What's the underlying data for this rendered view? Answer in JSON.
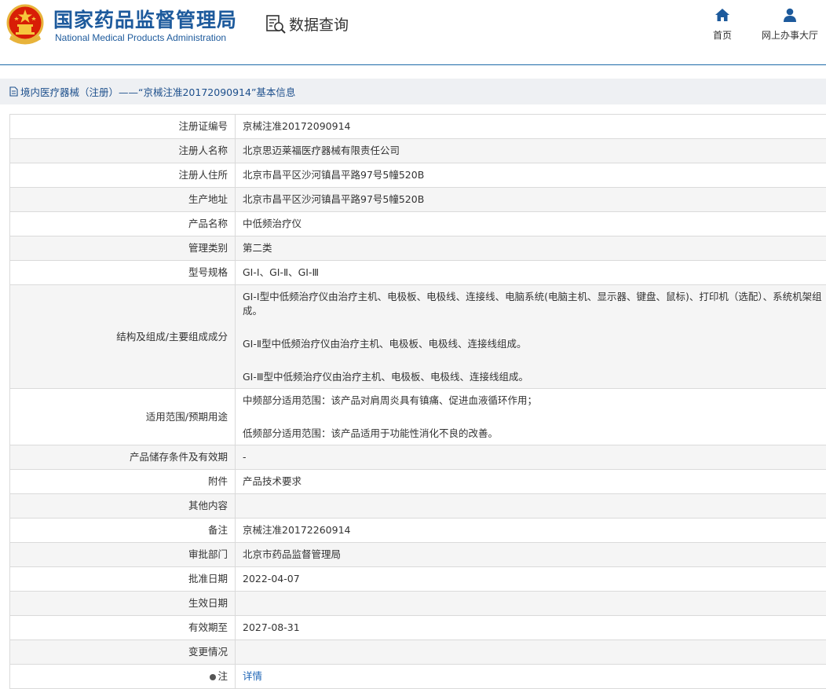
{
  "header": {
    "title_cn": "国家药品监督管理局",
    "title_en": "National Medical Products Administration",
    "data_query_label": "数据查询",
    "nav": [
      {
        "label": "首页",
        "icon": "home-icon"
      },
      {
        "label": "网上办事大厅",
        "icon": "user-icon"
      }
    ]
  },
  "breadcrumb": {
    "text": "境内医疗器械（注册）——“京械注准20172090914”基本信息",
    "icon": "document-icon"
  },
  "colors": {
    "brand_blue": "#1d5a9c",
    "header_rule": "#1c6aa8",
    "link": "#1f66b6",
    "row_alt": "#f5f5f5"
  },
  "rows": [
    {
      "label": "注册证编号",
      "value": "京械注准20172090914"
    },
    {
      "label": "注册人名称",
      "value": "北京思迈莱福医疗器械有限责任公司"
    },
    {
      "label": "注册人住所",
      "value": "北京市昌平区沙河镇昌平路97号5幢520B"
    },
    {
      "label": "生产地址",
      "value": "北京市昌平区沙河镇昌平路97号5幢520B"
    },
    {
      "label": "产品名称",
      "value": "中低频治疗仪"
    },
    {
      "label": "管理类别",
      "value": "第二类"
    },
    {
      "label": "型号规格",
      "value": "GI-Ⅰ、GI-Ⅱ、GI-Ⅲ"
    },
    {
      "label": "结构及组成/主要组成成分",
      "paragraphs": [
        "GI-Ⅰ型中低频治疗仪由治疗主机、电极板、电极线、连接线、电脑系统(电脑主机、显示器、键盘、鼠标)、打印机（选配）、系统机架组成。",
        "GI-Ⅱ型中低频治疗仪由治疗主机、电极板、电极线、连接线组成。",
        "GI-Ⅲ型中低频治疗仪由治疗主机、电极板、电极线、连接线组成。"
      ]
    },
    {
      "label": "适用范围/预期用途",
      "paragraphs": [
        "中频部分适用范围：该产品对肩周炎具有镇痛、促进血液循环作用；",
        "低频部分适用范围：该产品适用于功能性消化不良的改善。"
      ]
    },
    {
      "label": "产品储存条件及有效期",
      "value": "-"
    },
    {
      "label": "附件",
      "value": "产品技术要求"
    },
    {
      "label": "其他内容",
      "value": ""
    },
    {
      "label": "备注",
      "value": "京械注准20172260914"
    },
    {
      "label": "审批部门",
      "value": "北京市药品监督管理局"
    },
    {
      "label": "批准日期",
      "value": "2022-04-07"
    },
    {
      "label": "生效日期",
      "value": ""
    },
    {
      "label": "有效期至",
      "value": "2027-08-31"
    },
    {
      "label": "变更情况",
      "value": ""
    },
    {
      "label": "注",
      "value": "详情",
      "link": true
    }
  ]
}
